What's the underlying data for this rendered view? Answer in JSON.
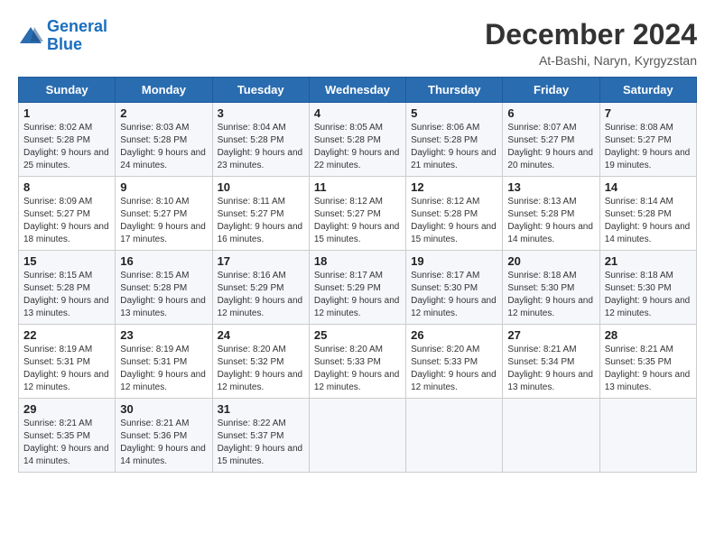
{
  "logo": {
    "line1": "General",
    "line2": "Blue"
  },
  "title": "December 2024",
  "location": "At-Bashi, Naryn, Kyrgyzstan",
  "weekdays": [
    "Sunday",
    "Monday",
    "Tuesday",
    "Wednesday",
    "Thursday",
    "Friday",
    "Saturday"
  ],
  "weeks": [
    [
      {
        "day": "1",
        "rise": "Sunrise: 8:02 AM",
        "set": "Sunset: 5:28 PM",
        "daylight": "Daylight: 9 hours and 25 minutes."
      },
      {
        "day": "2",
        "rise": "Sunrise: 8:03 AM",
        "set": "Sunset: 5:28 PM",
        "daylight": "Daylight: 9 hours and 24 minutes."
      },
      {
        "day": "3",
        "rise": "Sunrise: 8:04 AM",
        "set": "Sunset: 5:28 PM",
        "daylight": "Daylight: 9 hours and 23 minutes."
      },
      {
        "day": "4",
        "rise": "Sunrise: 8:05 AM",
        "set": "Sunset: 5:28 PM",
        "daylight": "Daylight: 9 hours and 22 minutes."
      },
      {
        "day": "5",
        "rise": "Sunrise: 8:06 AM",
        "set": "Sunset: 5:28 PM",
        "daylight": "Daylight: 9 hours and 21 minutes."
      },
      {
        "day": "6",
        "rise": "Sunrise: 8:07 AM",
        "set": "Sunset: 5:27 PM",
        "daylight": "Daylight: 9 hours and 20 minutes."
      },
      {
        "day": "7",
        "rise": "Sunrise: 8:08 AM",
        "set": "Sunset: 5:27 PM",
        "daylight": "Daylight: 9 hours and 19 minutes."
      }
    ],
    [
      {
        "day": "8",
        "rise": "Sunrise: 8:09 AM",
        "set": "Sunset: 5:27 PM",
        "daylight": "Daylight: 9 hours and 18 minutes."
      },
      {
        "day": "9",
        "rise": "Sunrise: 8:10 AM",
        "set": "Sunset: 5:27 PM",
        "daylight": "Daylight: 9 hours and 17 minutes."
      },
      {
        "day": "10",
        "rise": "Sunrise: 8:11 AM",
        "set": "Sunset: 5:27 PM",
        "daylight": "Daylight: 9 hours and 16 minutes."
      },
      {
        "day": "11",
        "rise": "Sunrise: 8:12 AM",
        "set": "Sunset: 5:27 PM",
        "daylight": "Daylight: 9 hours and 15 minutes."
      },
      {
        "day": "12",
        "rise": "Sunrise: 8:12 AM",
        "set": "Sunset: 5:28 PM",
        "daylight": "Daylight: 9 hours and 15 minutes."
      },
      {
        "day": "13",
        "rise": "Sunrise: 8:13 AM",
        "set": "Sunset: 5:28 PM",
        "daylight": "Daylight: 9 hours and 14 minutes."
      },
      {
        "day": "14",
        "rise": "Sunrise: 8:14 AM",
        "set": "Sunset: 5:28 PM",
        "daylight": "Daylight: 9 hours and 14 minutes."
      }
    ],
    [
      {
        "day": "15",
        "rise": "Sunrise: 8:15 AM",
        "set": "Sunset: 5:28 PM",
        "daylight": "Daylight: 9 hours and 13 minutes."
      },
      {
        "day": "16",
        "rise": "Sunrise: 8:15 AM",
        "set": "Sunset: 5:28 PM",
        "daylight": "Daylight: 9 hours and 13 minutes."
      },
      {
        "day": "17",
        "rise": "Sunrise: 8:16 AM",
        "set": "Sunset: 5:29 PM",
        "daylight": "Daylight: 9 hours and 12 minutes."
      },
      {
        "day": "18",
        "rise": "Sunrise: 8:17 AM",
        "set": "Sunset: 5:29 PM",
        "daylight": "Daylight: 9 hours and 12 minutes."
      },
      {
        "day": "19",
        "rise": "Sunrise: 8:17 AM",
        "set": "Sunset: 5:30 PM",
        "daylight": "Daylight: 9 hours and 12 minutes."
      },
      {
        "day": "20",
        "rise": "Sunrise: 8:18 AM",
        "set": "Sunset: 5:30 PM",
        "daylight": "Daylight: 9 hours and 12 minutes."
      },
      {
        "day": "21",
        "rise": "Sunrise: 8:18 AM",
        "set": "Sunset: 5:30 PM",
        "daylight": "Daylight: 9 hours and 12 minutes."
      }
    ],
    [
      {
        "day": "22",
        "rise": "Sunrise: 8:19 AM",
        "set": "Sunset: 5:31 PM",
        "daylight": "Daylight: 9 hours and 12 minutes."
      },
      {
        "day": "23",
        "rise": "Sunrise: 8:19 AM",
        "set": "Sunset: 5:31 PM",
        "daylight": "Daylight: 9 hours and 12 minutes."
      },
      {
        "day": "24",
        "rise": "Sunrise: 8:20 AM",
        "set": "Sunset: 5:32 PM",
        "daylight": "Daylight: 9 hours and 12 minutes."
      },
      {
        "day": "25",
        "rise": "Sunrise: 8:20 AM",
        "set": "Sunset: 5:33 PM",
        "daylight": "Daylight: 9 hours and 12 minutes."
      },
      {
        "day": "26",
        "rise": "Sunrise: 8:20 AM",
        "set": "Sunset: 5:33 PM",
        "daylight": "Daylight: 9 hours and 12 minutes."
      },
      {
        "day": "27",
        "rise": "Sunrise: 8:21 AM",
        "set": "Sunset: 5:34 PM",
        "daylight": "Daylight: 9 hours and 13 minutes."
      },
      {
        "day": "28",
        "rise": "Sunrise: 8:21 AM",
        "set": "Sunset: 5:35 PM",
        "daylight": "Daylight: 9 hours and 13 minutes."
      }
    ],
    [
      {
        "day": "29",
        "rise": "Sunrise: 8:21 AM",
        "set": "Sunset: 5:35 PM",
        "daylight": "Daylight: 9 hours and 14 minutes."
      },
      {
        "day": "30",
        "rise": "Sunrise: 8:21 AM",
        "set": "Sunset: 5:36 PM",
        "daylight": "Daylight: 9 hours and 14 minutes."
      },
      {
        "day": "31",
        "rise": "Sunrise: 8:22 AM",
        "set": "Sunset: 5:37 PM",
        "daylight": "Daylight: 9 hours and 15 minutes."
      },
      null,
      null,
      null,
      null
    ]
  ]
}
